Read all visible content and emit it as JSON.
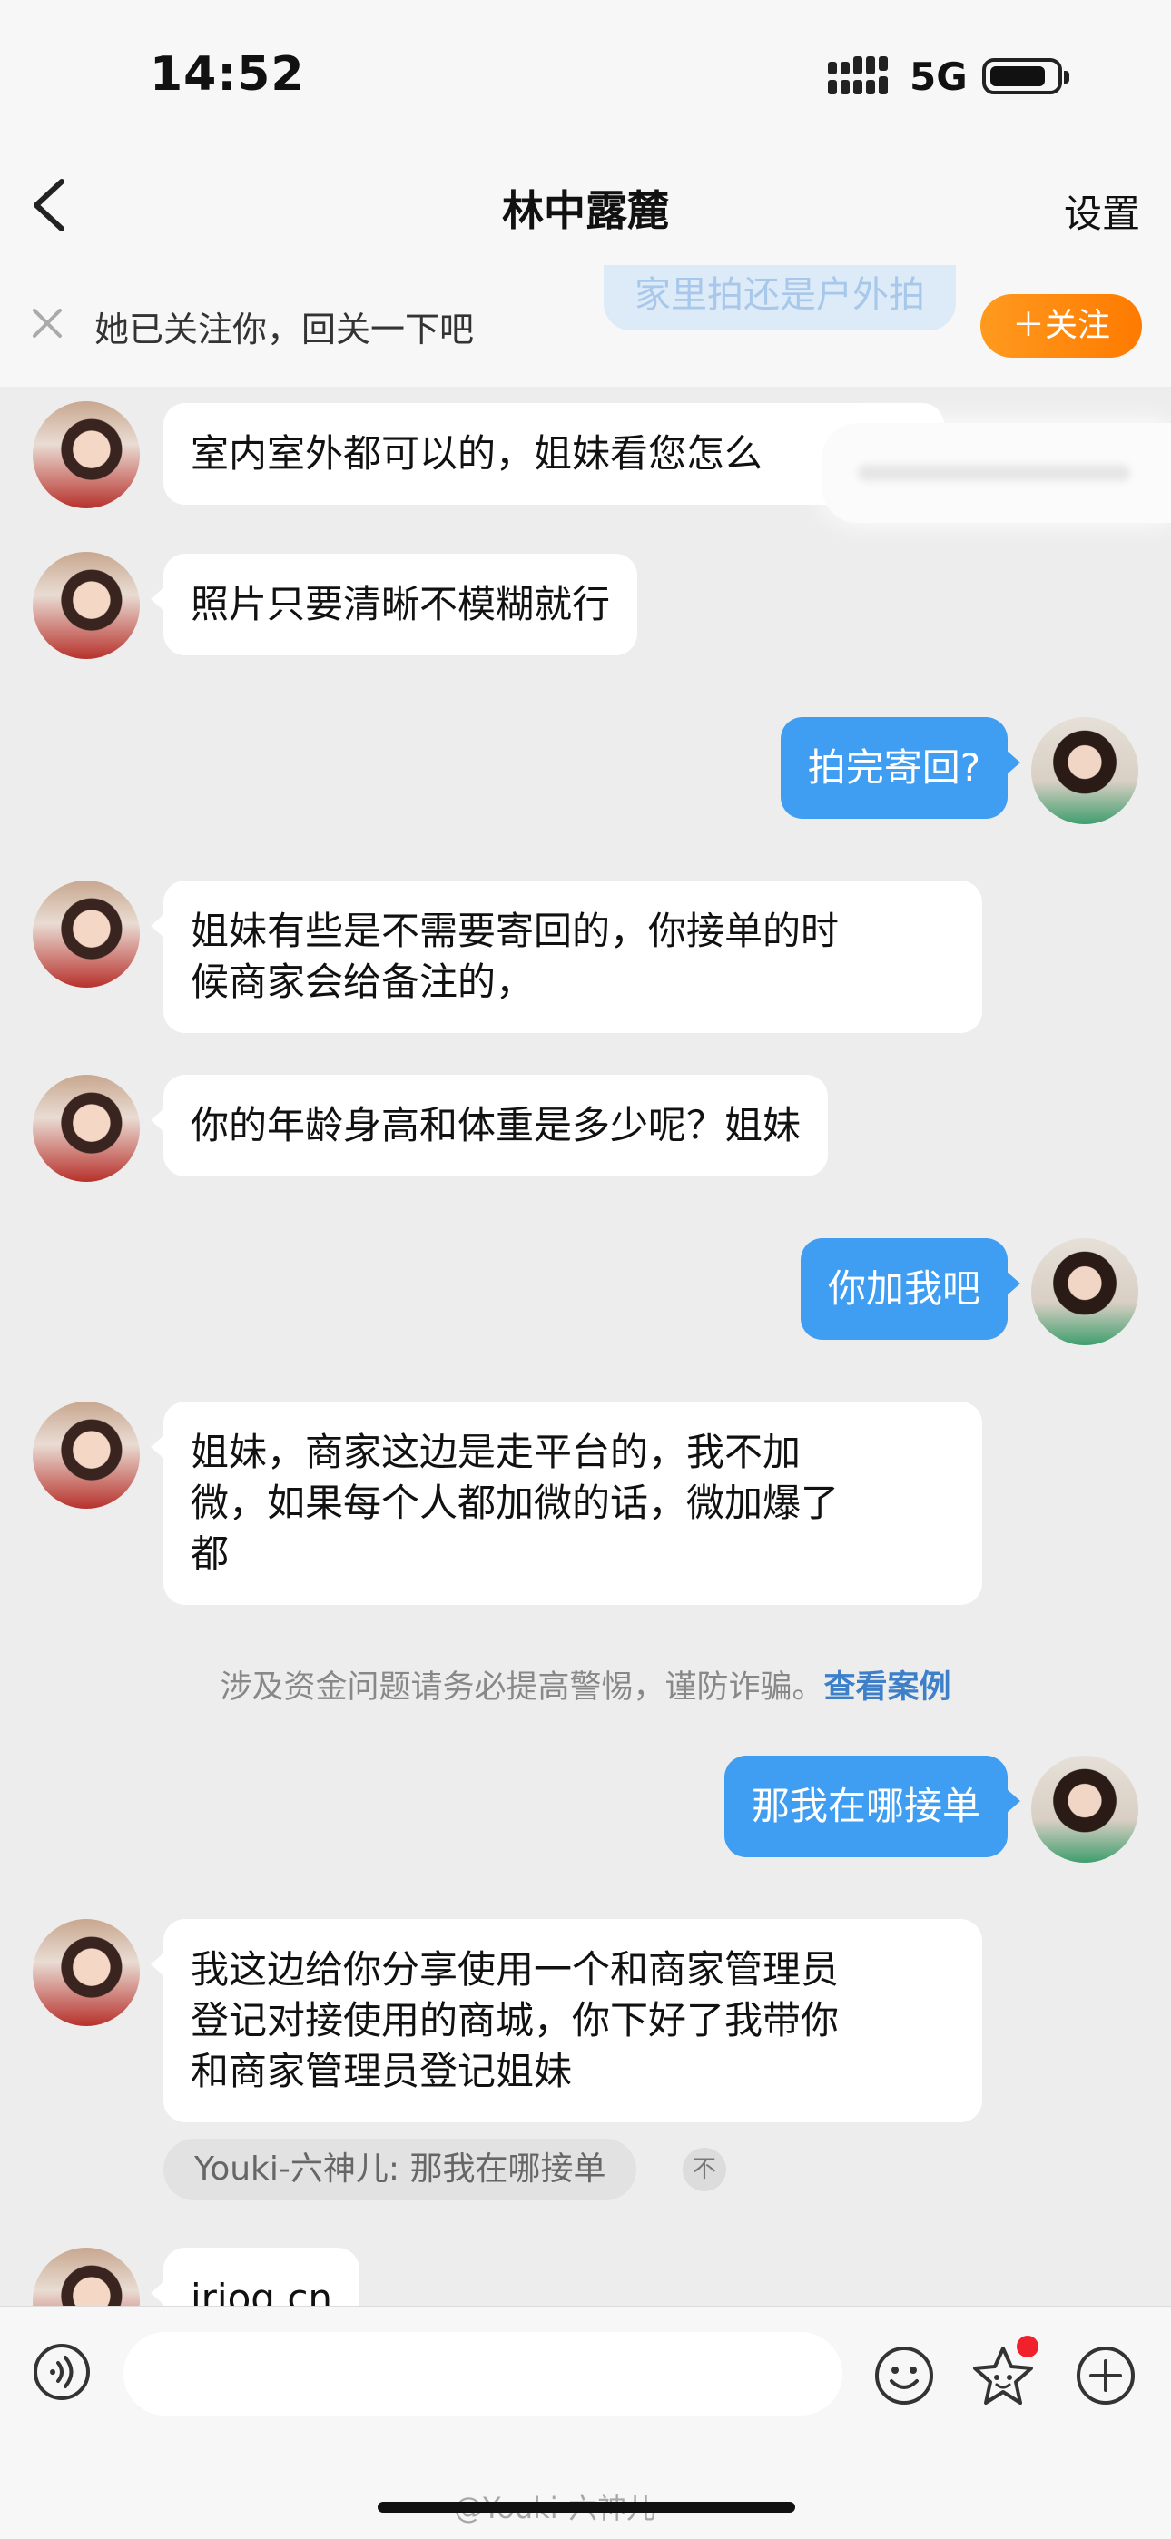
{
  "status_bar": {
    "time": "14:52",
    "network": "5G"
  },
  "nav": {
    "title": "林中露麓",
    "settings": "设置"
  },
  "follow_banner": {
    "text": "她已关注你，回关一下吧",
    "button": "＋关注",
    "ghost_text": "家里拍还是户外拍"
  },
  "messages": [
    {
      "side": "in",
      "text": "室内室外都可以的，姐妹看您怎么"
    },
    {
      "side": "in",
      "text": "照片只要清晰不模糊就行"
    },
    {
      "side": "out",
      "text": "拍完寄回?"
    },
    {
      "side": "in",
      "lines": [
        "姐妹有些是不需要寄回的，你接单的时",
        "候商家会给备注的，"
      ]
    },
    {
      "side": "in",
      "text": "你的年龄身高和体重是多少呢？姐妹"
    },
    {
      "side": "out",
      "text": "你加我吧"
    },
    {
      "side": "in",
      "lines": [
        "姐妹，商家这边是走平台的，我不加",
        "微，如果每个人都加微的话，微加爆了",
        "都"
      ]
    },
    {
      "side": "out",
      "text": "那我在哪接单"
    },
    {
      "side": "in",
      "lines": [
        "我这边给你分享使用一个和商家管理员",
        "登记对接使用的商城，你下好了我带你",
        "和商家管理员登记姐妹"
      ]
    },
    {
      "side": "in",
      "text": "irioq.cn"
    }
  ],
  "warning": {
    "text": "涉及资金问题请务必提高警惕，谨防诈骗。",
    "link": "查看案例"
  },
  "quote": {
    "text": "Youki-六神儿: 那我在哪接单",
    "icon_glyph": "不"
  },
  "input": {
    "placeholder": ""
  },
  "watermark": "@Youki-六神儿"
}
